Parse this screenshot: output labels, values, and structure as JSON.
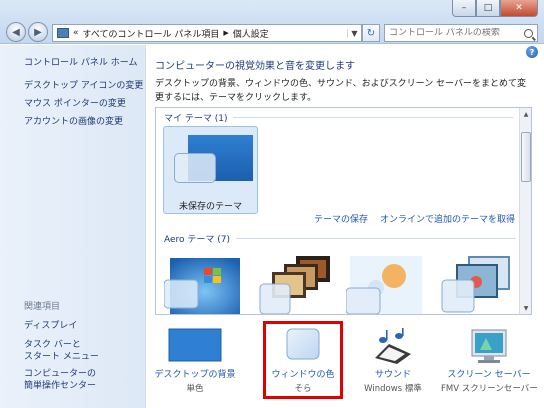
{
  "titlebar": {
    "minimize": "–",
    "maximize": "□",
    "close": "✕"
  },
  "nav": {
    "back": "◀",
    "forward": "▶"
  },
  "address": {
    "prefix": "«",
    "crumb1": "すべてのコントロール パネル項目",
    "sep": "▶",
    "crumb2": "個人設定",
    "drop": "▼"
  },
  "refresh": "↻",
  "search": {
    "placeholder": "コントロール パネルの検索"
  },
  "left": {
    "home": "コントロール パネル ホーム",
    "links": [
      "デスクトップ アイコンの変更",
      "マウス ポインターの変更",
      "アカウントの画像の変更"
    ],
    "related_title": "関連項目",
    "related": [
      "ディスプレイ",
      "タスク バーと",
      "スタート メニュー",
      "コンピューターの",
      "簡単操作センター"
    ]
  },
  "main": {
    "help": "?",
    "heading": "コンピューターの視覚効果と音を変更します",
    "desc": "デスクトップの背景、ウィンドウの色、サウンド、およびスクリーン セーバーをまとめて変更するには、テーマをクリックします。",
    "my_themes": "マイ テーマ (1)",
    "unsaved_theme": "未保存のテーマ",
    "save_theme": "テーマの保存",
    "online_themes": "オンラインで追加のテーマを取得",
    "aero_themes": "Aero テーマ (7)"
  },
  "options": [
    {
      "title": "デスクトップの背景",
      "sub": "単色",
      "icon": "desktop-background-icon"
    },
    {
      "title": "ウィンドウの色",
      "sub": "そら",
      "icon": "window-color-icon"
    },
    {
      "title": "サウンド",
      "sub": "Windows 標準",
      "icon": "sound-icon"
    },
    {
      "title": "スクリーン セーバー",
      "sub": "FMV スクリーンセーバー",
      "icon": "screen-saver-icon"
    }
  ],
  "colors": {
    "accent": "#1f56b5",
    "highlight": "#e10000"
  }
}
